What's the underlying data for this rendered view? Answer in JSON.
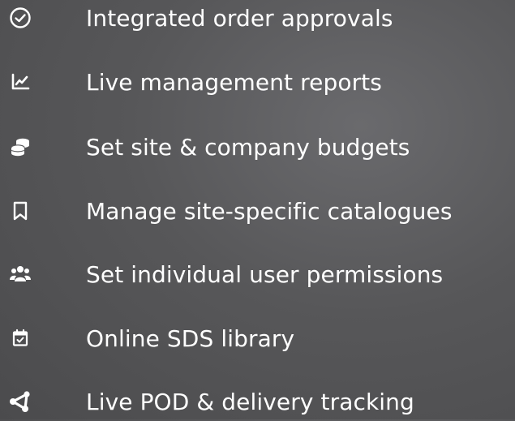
{
  "features": [
    {
      "icon": "check-circle-icon",
      "label": "Integrated order approvals"
    },
    {
      "icon": "line-chart-icon",
      "label": "Live management reports"
    },
    {
      "icon": "coins-stack-icon",
      "label": "Set site & company budgets"
    },
    {
      "icon": "bookmark-icon",
      "label": "Manage site-specific catalogues"
    },
    {
      "icon": "users-group-icon",
      "label": "Set individual user permissions"
    },
    {
      "icon": "calendar-check-icon",
      "label": "Online SDS library"
    },
    {
      "icon": "route-share-icon",
      "label": "Live POD & delivery tracking"
    }
  ],
  "colors": {
    "text": "#ffffff",
    "background": "#5a5a5c"
  }
}
